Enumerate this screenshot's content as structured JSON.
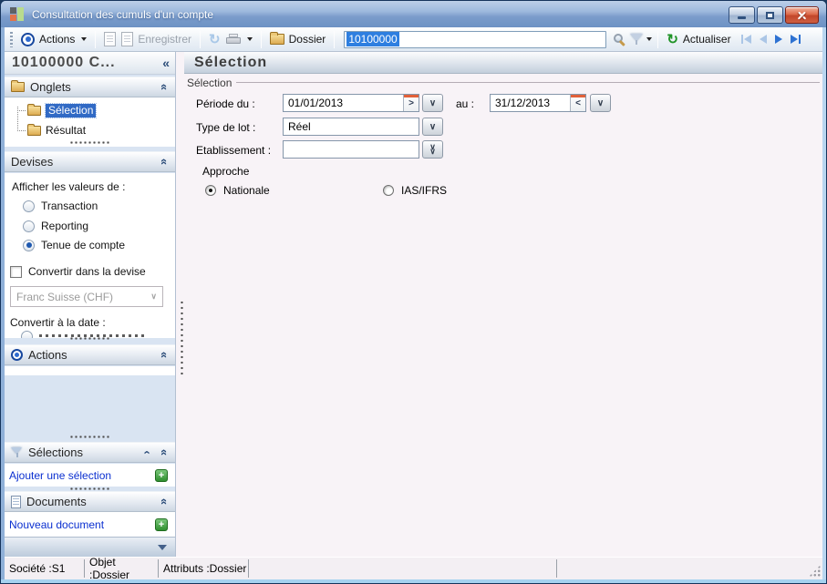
{
  "window": {
    "title": "Consultation des cumuls d'un compte"
  },
  "toolbar": {
    "actions_label": "Actions",
    "enregistrer_label": "Enregistrer",
    "dossier_label": "Dossier",
    "account_value": "10100000",
    "actualiser_label": "Actualiser"
  },
  "sidebar": {
    "header": "10100000 C...",
    "onglets": {
      "title": "Onglets",
      "items": [
        {
          "label": "Sélection",
          "selected": true
        },
        {
          "label": "Résultat",
          "selected": false
        }
      ]
    },
    "devises": {
      "title": "Devises",
      "show_values_label": "Afficher les valeurs de :",
      "options": [
        {
          "label": "Transaction",
          "selected": false
        },
        {
          "label": "Reporting",
          "selected": false
        },
        {
          "label": "Tenue de compte",
          "selected": true
        }
      ],
      "convert_checkbox_label": "Convertir dans la devise",
      "convert_checkbox_checked": false,
      "currency_value": "Franc Suisse (CHF)",
      "convert_date_label": "Convertir à la date :"
    },
    "actions_panel": {
      "title": "Actions"
    },
    "selections_panel": {
      "title": "Sélections",
      "add_link": "Ajouter une sélection"
    },
    "documents_panel": {
      "title": "Documents",
      "add_link": "Nouveau document"
    }
  },
  "main": {
    "title": "Sélection",
    "group_label": "Sélection",
    "periode": {
      "label": "Période du :",
      "value": "01/01/2013"
    },
    "au": {
      "label": "au :",
      "value": "31/12/2013"
    },
    "type_lot": {
      "label": "Type de lot :",
      "value": "Réel"
    },
    "etablissement": {
      "label": "Etablissement :",
      "value": ""
    },
    "approche": {
      "label": "Approche",
      "options": [
        {
          "label": "Nationale",
          "selected": true
        },
        {
          "label": "IAS/IFRS",
          "selected": false
        }
      ]
    }
  },
  "statusbar": {
    "cells": [
      "Société :S1",
      "Objet :Dossier",
      "Attributs :Dossier"
    ]
  },
  "colors": {
    "selection_blue": "#316ac5",
    "link_blue": "#0a2fd0",
    "title_gradient_top": "#bccfe8",
    "close_red": "#c2462b",
    "picker_orange": "#e2613a",
    "plus_green": "#2f8f2f"
  },
  "icons": {
    "collapse_left": "«",
    "chevron_double": "«",
    "chevron_single": "‹",
    "dropdown_v": "∨",
    "picker_next": ">",
    "picker_prev": "<",
    "plus": "+",
    "refresh_glyph": "↻"
  }
}
